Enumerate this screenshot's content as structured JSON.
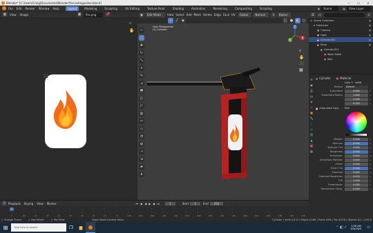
{
  "window": {
    "title": "Blender* [C:\\Users\\Craig\\Documents\\Blender\\fire-extinguisher.blend]",
    "min": "—",
    "max": "☐",
    "close": "✕"
  },
  "menu": {
    "items": [
      "File",
      "Edit",
      "Render",
      "Window",
      "Help"
    ],
    "workspaces": [
      "Layout",
      "Modeling",
      "Sculpting",
      "UV Editing",
      "Texture Paint",
      "Shading",
      "Animation",
      "Rendering",
      "Compositing",
      "Scripting"
    ],
    "active_workspace": "Layout",
    "scene": "Scene",
    "view_layer": "View Layer"
  },
  "image_editor": {
    "view": "View",
    "image": "Image",
    "file": "fire.png"
  },
  "viewport": {
    "mode": "Edit Mode",
    "view": "View",
    "select": "Select",
    "add": "Add",
    "mesh": "Mesh",
    "vertex": "Vertex",
    "edge": "Edge",
    "face": "Face",
    "uv": "UV",
    "orientation": "Global",
    "pivot": "Normal",
    "proportional": "Bezier",
    "overlay_text": "User Perspective",
    "object_text": "(1) Cylinder",
    "axis_x": "X",
    "axis_y": "Y",
    "axis_z": "Z"
  },
  "outliner": {
    "search_placeholder": "",
    "rows": [
      {
        "label": "Scene Collection",
        "depth": 0,
        "sel": false,
        "color": "#dddddd",
        "icon": "▭"
      },
      {
        "label": "Collection",
        "depth": 1,
        "sel": false,
        "color": "#dddddd",
        "icon": "▾"
      },
      {
        "label": "Camera",
        "depth": 2,
        "sel": false,
        "color": "#d07b4c",
        "icon": "■"
      },
      {
        "label": "Light",
        "depth": 2,
        "sel": false,
        "color": "#d0b24c",
        "icon": "●"
      },
      {
        "label": "Cylinder.001",
        "depth": 2,
        "sel": true,
        "color": "#ffffff",
        "icon": "▲"
      },
      {
        "label": "Plane",
        "depth": 2,
        "sel": false,
        "color": "#dddddd",
        "icon": "▲"
      },
      {
        "label": "Cylinder.001",
        "depth": 3,
        "sel": false,
        "color": "#dddddd",
        "icon": "▲"
      },
      {
        "label": "Black Metal",
        "depth": 4,
        "sel": false,
        "color": "#e07070",
        "icon": "●"
      },
      {
        "label": "Red",
        "depth": 4,
        "sel": false,
        "color": "#e07070",
        "icon": "●"
      }
    ]
  },
  "properties": {
    "object": "Cylinder",
    "material": "Material",
    "slot": "Color 5",
    "dupe": "x6/0B",
    "subsurface_method_label": "Method",
    "subsurface_method_value": "Default",
    "fields": [
      {
        "label": "Subsurface",
        "value": "0.000",
        "blue": false
      },
      {
        "label": "Subsurface Radius",
        "value": "1.000",
        "blue": false
      },
      {
        "label": "",
        "value": "0.200",
        "blue": false
      },
      {
        "label": "",
        "value": "0.100",
        "blue": false
      }
    ],
    "subsurface_color_label": "Subsurface Color",
    "subsurface_color_value": "RGB",
    "fields2": [
      {
        "label": "Metallic",
        "value": "0.000",
        "blue": false
      },
      {
        "label": "Specular",
        "value": "0.500",
        "blue": true
      },
      {
        "label": "Specular Tint",
        "value": "0.000",
        "blue": false
      },
      {
        "label": "Roughness",
        "value": "0.500",
        "blue": true
      },
      {
        "label": "Anisotropic",
        "value": "0.000",
        "blue": false
      },
      {
        "label": "Anisotropic Rotation",
        "value": "0.000",
        "blue": false
      },
      {
        "label": "Sheen",
        "value": "0.000",
        "blue": false
      },
      {
        "label": "Sheen Tint",
        "value": "0.500",
        "blue": true
      },
      {
        "label": "Clearcoat",
        "value": "0.000",
        "blue": false
      },
      {
        "label": "Clearcoat Roughness",
        "value": "0.030",
        "blue": false
      },
      {
        "label": "IOR",
        "value": "1.450",
        "blue": false
      },
      {
        "label": "Transmission",
        "value": "0.000",
        "blue": false
      },
      {
        "label": "Transmission Roug.",
        "value": "0.000",
        "blue": false
      }
    ]
  },
  "timeline": {
    "menus": [
      "Playback",
      "Keying",
      "View",
      "Marker"
    ],
    "current_frame": "1",
    "start_label": "Start",
    "start": "1",
    "end_label": "End",
    "end": "250",
    "ticks": [
      "0",
      "10",
      "20",
      "30",
      "40",
      "50",
      "60",
      "70",
      "80",
      "90",
      "100",
      "110",
      "120",
      "130",
      "140",
      "150",
      "160",
      "170",
      "180",
      "190",
      "200",
      "210",
      "220",
      "230",
      "240",
      "250"
    ]
  },
  "status": {
    "left1": "Change Frame",
    "left2": "Box Select",
    "left3": "Pan View",
    "middle": "Dope Sheet Context Menu",
    "right": "Cylinder | Verts 0/112 | Edges 0/168 | Faces 0/58 | Tris 0/216 | Objects 0/1 | 2.83.0"
  },
  "taskbar": {
    "search_placeholder": "Type here to search",
    "time": "1:59 AM",
    "date": "5/3/2020"
  },
  "colors": {
    "accent": "#5680c2",
    "extinguisher": "#b52222",
    "flame_outer": "#f26b1d",
    "flame_inner": "#ffc233"
  }
}
